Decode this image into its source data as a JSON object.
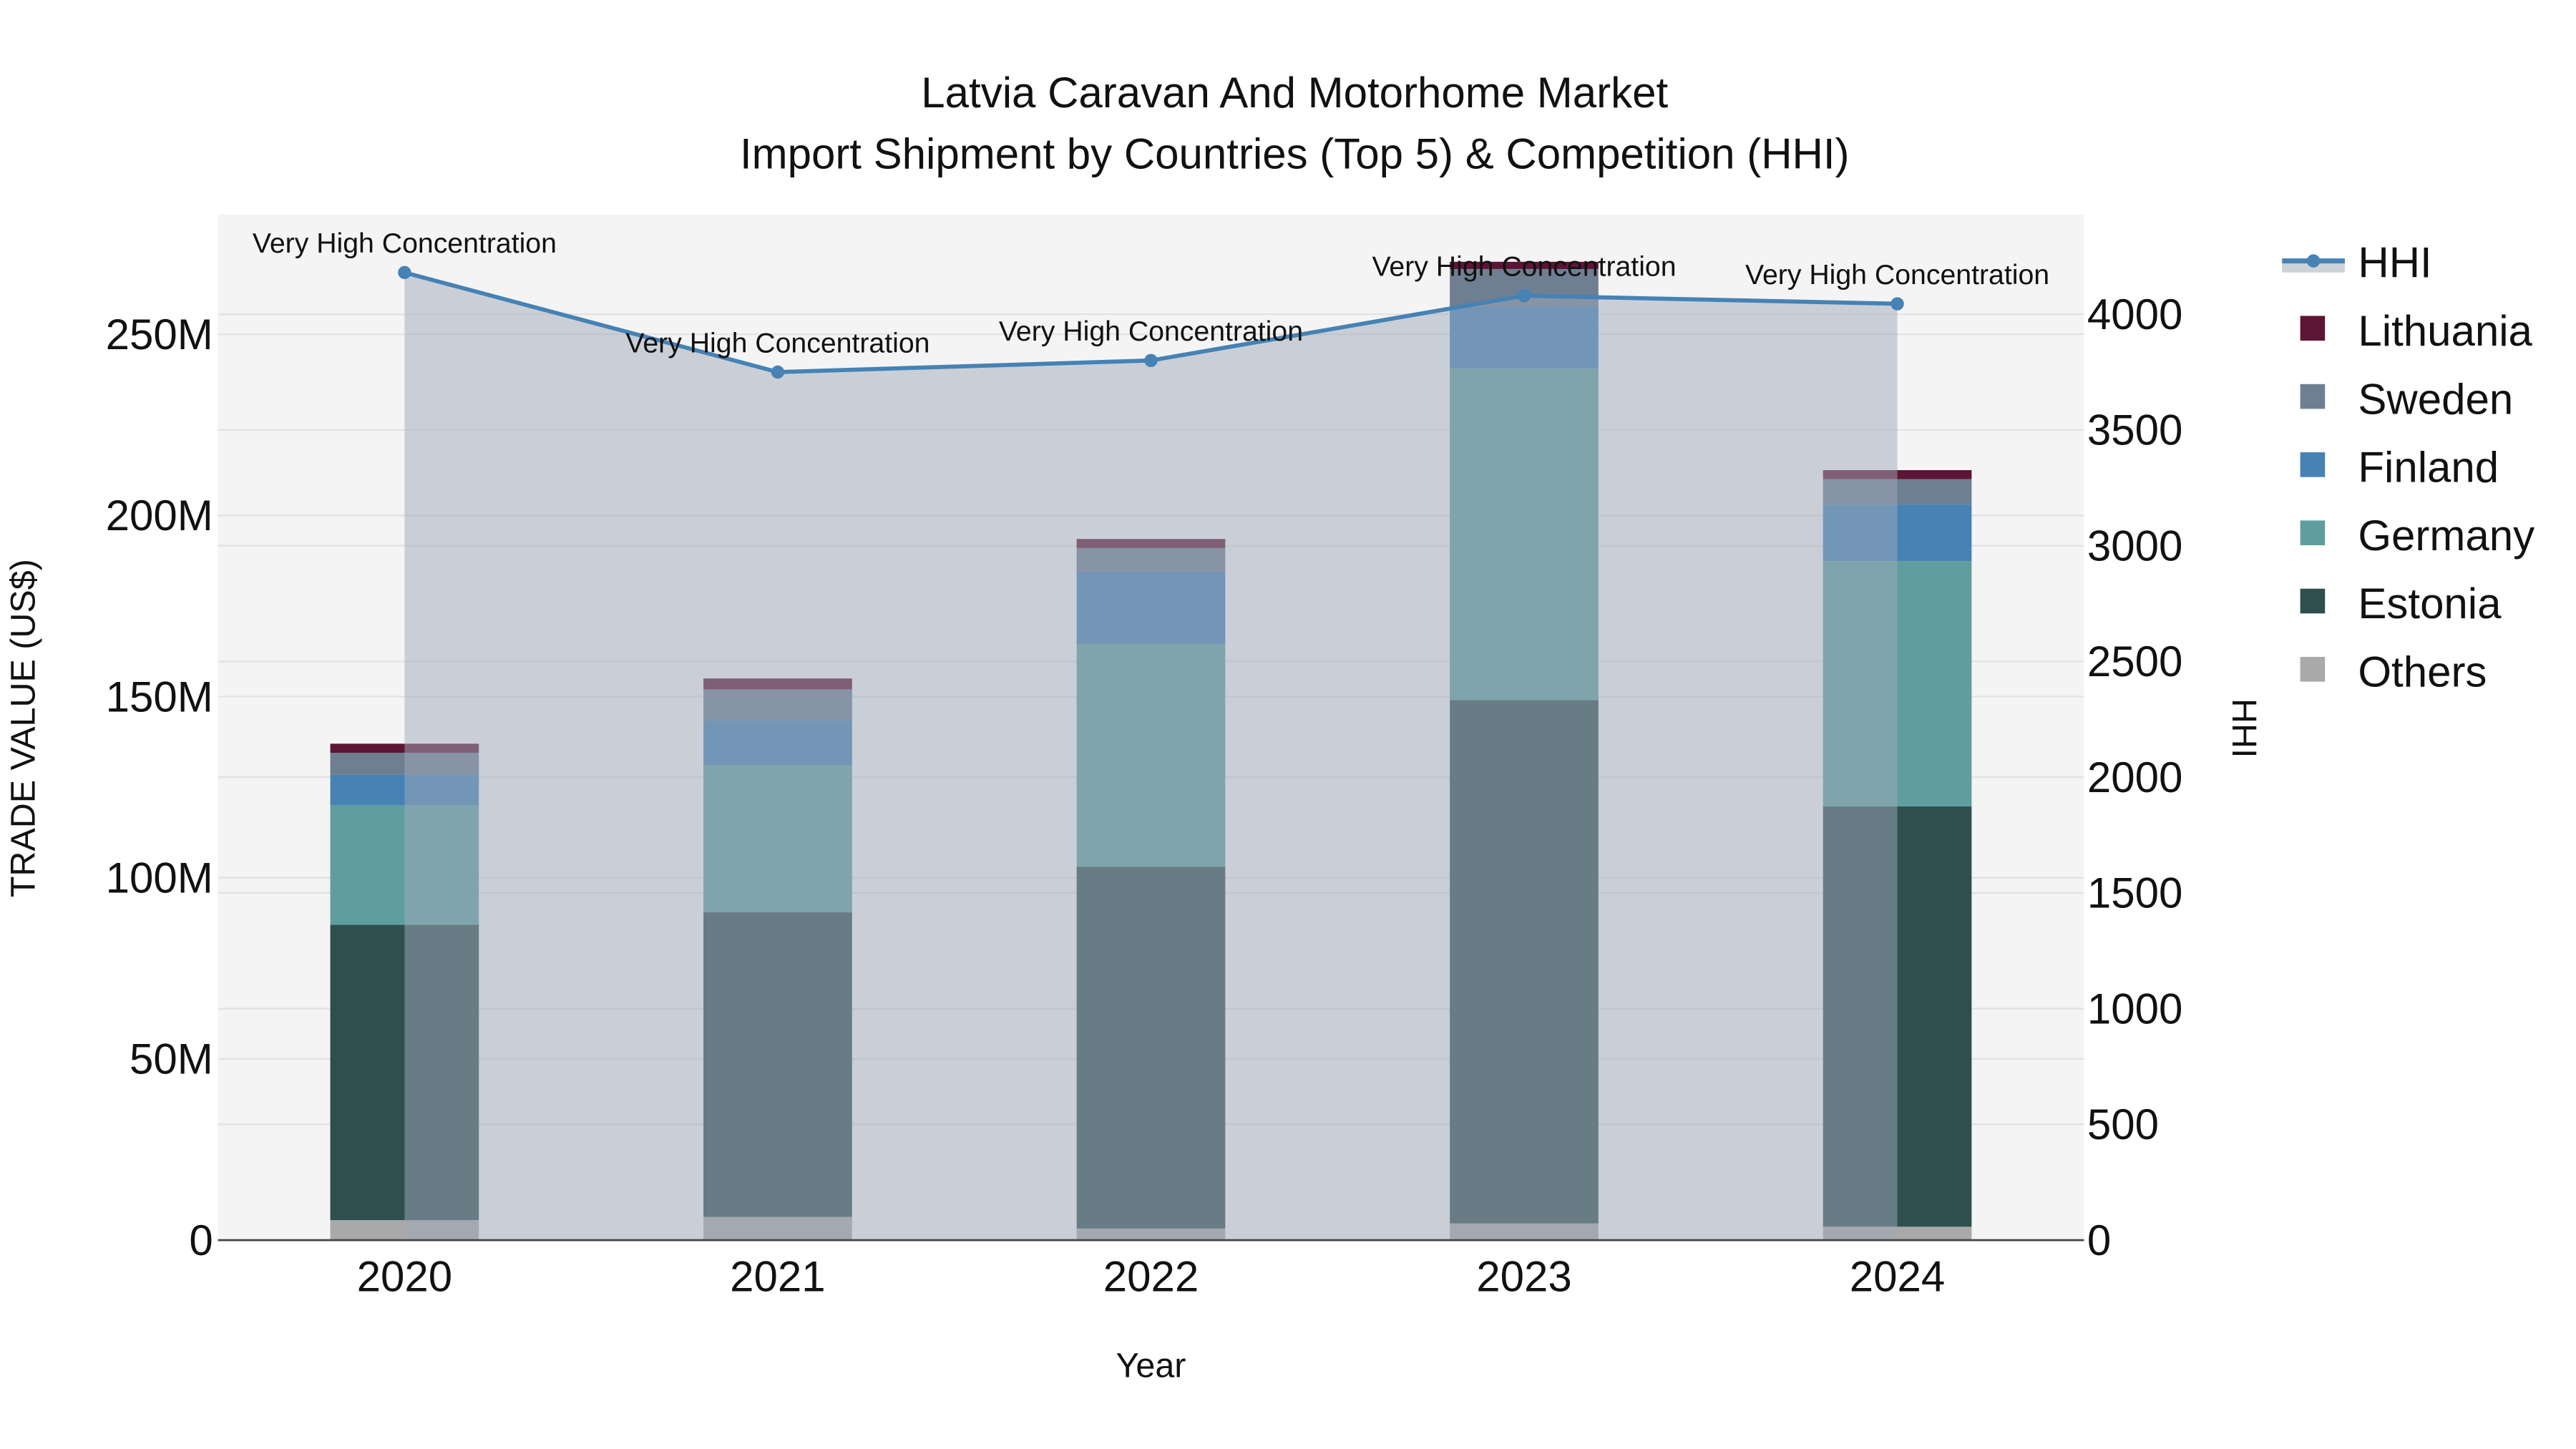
{
  "chart_data": {
    "type": "bar",
    "title": "Latvia Caravan And Motorhome Market",
    "subtitle": "Import Shipment by Countries (Top 5) & Competition (HHI)",
    "xlabel": "Year",
    "ylabel": "TRADE VALUE (US$)",
    "y2label": "HHI",
    "categories": [
      "2020",
      "2021",
      "2022",
      "2023",
      "2024"
    ],
    "ylim": [
      0,
      283
    ],
    "y_unit": "M",
    "y_ticks": [
      0,
      50,
      100,
      150,
      200,
      250
    ],
    "y_tick_labels": [
      "0",
      "50M",
      "100M",
      "150M",
      "200M",
      "250M"
    ],
    "y2lim": [
      0,
      4430
    ],
    "y2_ticks": [
      0,
      500,
      1000,
      1500,
      2000,
      2500,
      3000,
      3500,
      4000
    ],
    "y2_tick_labels": [
      "0",
      "500",
      "1000",
      "1500",
      "2000",
      "2500",
      "3000",
      "3500",
      "4000"
    ],
    "grid": true,
    "legend_position": "right",
    "series": [
      {
        "name": "Others",
        "color": "#a9a9a9",
        "values": [
          5.5,
          6.4,
          3.2,
          4.6,
          3.7
        ]
      },
      {
        "name": "Estonia",
        "color": "#2f4f4f",
        "values": [
          81.5,
          84.1,
          99.8,
          144.4,
          116.0
        ]
      },
      {
        "name": "Germany",
        "color": "#5f9e9e",
        "values": [
          33.0,
          40.5,
          61.5,
          91.5,
          67.7
        ]
      },
      {
        "name": "Finland",
        "color": "#4682b4",
        "values": [
          8.5,
          12.5,
          20.0,
          17.2,
          15.6
        ]
      },
      {
        "name": "Sweden",
        "color": "#6e7f92",
        "values": [
          6.0,
          8.5,
          6.5,
          10.3,
          7.0
        ]
      },
      {
        "name": "Lithuania",
        "color": "#5e1535",
        "values": [
          2.5,
          3.0,
          2.5,
          2.0,
          2.5
        ]
      }
    ],
    "hhi": {
      "name": "HHI",
      "color": "#4682b4",
      "values": [
        4180,
        3750,
        3800,
        4080,
        4045
      ],
      "annotations": [
        "Very High Concentration",
        "Very High Concentration",
        "Very High Concentration",
        "Very High Concentration",
        "Very High Concentration"
      ]
    },
    "legend_order": [
      "HHI",
      "Lithuania",
      "Sweden",
      "Finland",
      "Germany",
      "Estonia",
      "Others"
    ]
  }
}
